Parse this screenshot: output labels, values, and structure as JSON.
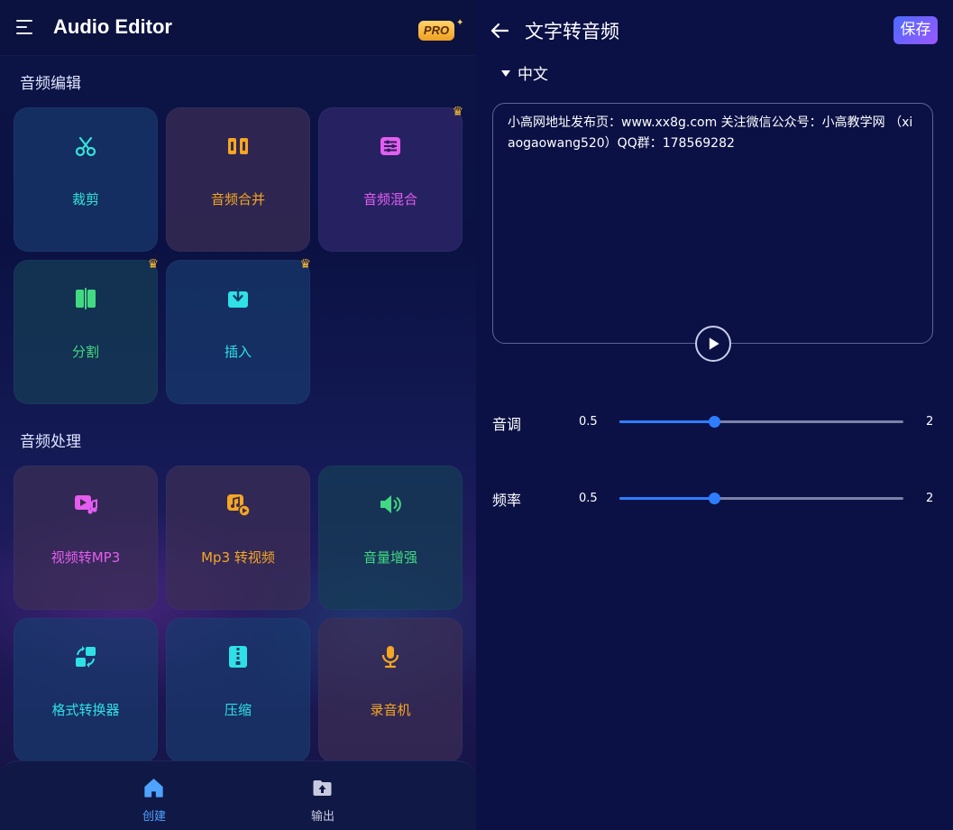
{
  "left": {
    "app_title": "Audio Editor",
    "pro_badge": "PRO",
    "section_edit_title": "音频编辑",
    "section_process_title": "音频处理",
    "edit_tools": [
      {
        "label": "裁剪",
        "icon": "scissors-icon",
        "color": "#34e4d8",
        "pro": false
      },
      {
        "label": "音频合并",
        "icon": "merge-icon",
        "color": "#f5a623",
        "pro": false
      },
      {
        "label": "音频混合",
        "icon": "mixer-icon",
        "color": "#e55df0",
        "pro": true
      },
      {
        "label": "分割",
        "icon": "split-icon",
        "color": "#42d982",
        "pro": true
      },
      {
        "label": "插入",
        "icon": "insert-icon",
        "color": "#2fe0e6",
        "pro": true
      }
    ],
    "process_tools": [
      {
        "label": "视频转MP3",
        "icon": "video-to-mp3-icon",
        "color": "#e55df0"
      },
      {
        "label": "Mp3 转视频",
        "icon": "mp3-to-video-icon",
        "color": "#f5a623"
      },
      {
        "label": "音量增强",
        "icon": "volume-boost-icon",
        "color": "#42d982"
      },
      {
        "label": "格式转换器",
        "icon": "format-convert-icon",
        "color": "#2fe0e6"
      },
      {
        "label": "压缩",
        "icon": "compress-icon",
        "color": "#2fe0e6"
      },
      {
        "label": "录音机",
        "icon": "microphone-icon",
        "color": "#f5a623"
      }
    ],
    "nav": {
      "create_label": "创建",
      "output_label": "输出",
      "active_color": "#4fa3ff",
      "inactive_color": "#c8cbe0"
    }
  },
  "right": {
    "screen_title": "文字转音频",
    "save_label": "保存",
    "language": "中文",
    "text_content": "小高网地址发布页：www.xx8g.com  关注微信公众号：小高教学网 （xiaogaowang520）QQ群：178569282",
    "sliders": [
      {
        "label": "音调",
        "min_label": "0.5",
        "max_label": "2",
        "min": 0.5,
        "max": 2,
        "value": 1.0
      },
      {
        "label": "频率",
        "min_label": "0.5",
        "max_label": "2",
        "min": 0.5,
        "max": 2,
        "value": 1.0
      }
    ],
    "accent_color": "#2f7dff"
  }
}
